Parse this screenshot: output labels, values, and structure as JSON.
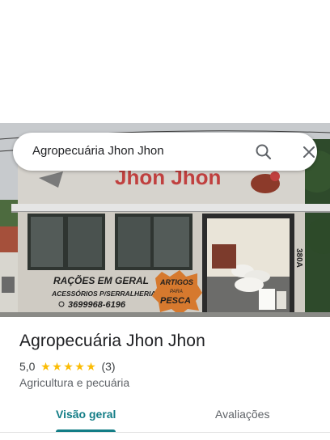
{
  "search": {
    "query": "Agropecuária Jhon Jhon"
  },
  "hero": {
    "sign_name": "Jhon Jhon",
    "wall_text_1": "RAÇÕES EM GERAL",
    "wall_text_2": "ACESSÓRIOS P/SERRALHERIA",
    "wall_phone": "3699968-6196",
    "wall_text_3": "ARTIGOS",
    "wall_text_4": "PARA",
    "wall_text_5": "PESCA",
    "house_number": "380A"
  },
  "place": {
    "name": "Agropecuária Jhon Jhon",
    "rating": "5,0",
    "stars": 5,
    "review_count": "(3)",
    "category": "Agricultura e pecuária"
  },
  "tabs": [
    {
      "label": "Visão geral",
      "selected": true
    },
    {
      "label": "Avaliações",
      "selected": false
    }
  ],
  "colors": {
    "accent": "#137d86",
    "star": "#fbbc04"
  },
  "icons": [
    "search-icon",
    "close-icon",
    "star-icon"
  ]
}
